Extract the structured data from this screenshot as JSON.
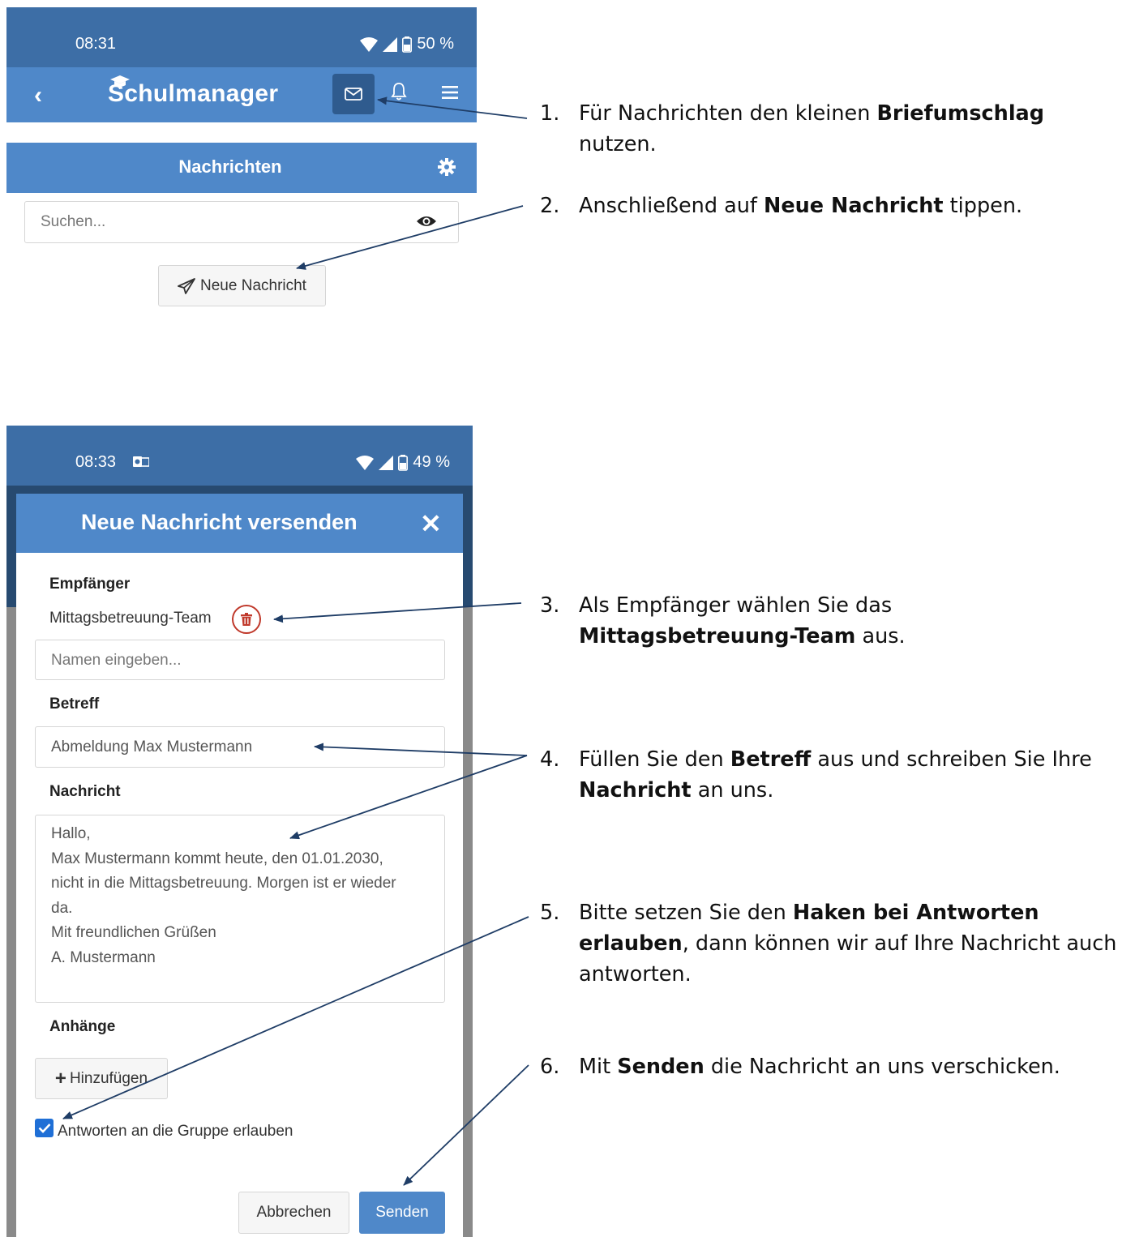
{
  "screen1": {
    "status": {
      "time": "08:31",
      "battery": "50 %"
    },
    "app": {
      "logo": "Schulmanager",
      "back_icon": "chevron-left-icon",
      "mail_icon": "envelope-icon",
      "bell_icon": "bell-icon",
      "menu_icon": "hamburger-menu-icon"
    },
    "section_title": "Nachrichten",
    "search_placeholder": "Suchen...",
    "new_message_label": "Neue Nachricht"
  },
  "screen2": {
    "status": {
      "time": "08:33",
      "battery": "49 %"
    },
    "modal_title": "Neue Nachricht versenden",
    "recipients_label": "Empfänger",
    "recipient": "Mittagsbetreuung-Team",
    "name_placeholder": "Namen eingeben...",
    "subject_label": "Betreff",
    "subject_value": "Abmeldung Max Mustermann",
    "message_label": "Nachricht",
    "message_lines": [
      "Hallo,",
      "Max Mustermann kommt heute, den 01.01.2030,",
      "nicht in die Mittagsbetreuung. Morgen ist er wieder",
      "da.",
      "Mit freundlichen Grüßen",
      "A. Mustermann"
    ],
    "attachments_label": "Anhänge",
    "add_label": "Hinzufügen",
    "allow_replies_label": "Antworten an die Gruppe erlauben",
    "allow_replies_checked": true,
    "cancel_label": "Abbrechen",
    "send_label": "Senden"
  },
  "steps": [
    {
      "num": "1.",
      "parts": [
        {
          "t": "Für Nachrichten den kleinen "
        },
        {
          "t": "Briefumschlag",
          "b": true
        },
        {
          "t": " nutzen."
        }
      ]
    },
    {
      "num": "2.",
      "parts": [
        {
          "t": "Anschließend auf "
        },
        {
          "t": "Neue Nachricht",
          "b": true
        },
        {
          "t": " tippen."
        }
      ]
    },
    {
      "num": "3.",
      "parts": [
        {
          "t": "Als Empfänger wählen Sie das "
        },
        {
          "t": "Mittagsbetreuung-Team",
          "b": true
        },
        {
          "t": " aus."
        }
      ]
    },
    {
      "num": "4.",
      "parts": [
        {
          "t": "Füllen Sie den "
        },
        {
          "t": "Betreff",
          "b": true
        },
        {
          "t": " aus und schreiben Sie Ihre "
        },
        {
          "t": "Nachricht",
          "b": true
        },
        {
          "t": " an uns."
        }
      ]
    },
    {
      "num": "5.",
      "parts": [
        {
          "t": "Bitte setzen Sie den "
        },
        {
          "t": "Haken bei Antworten erlauben",
          "b": true
        },
        {
          "t": ", dann können wir auf Ihre Nachricht auch antworten."
        }
      ]
    },
    {
      "num": "6.",
      "parts": [
        {
          "t": "Mit "
        },
        {
          "t": "Senden",
          "b": true
        },
        {
          "t": " die Nachricht an uns verschicken."
        }
      ]
    }
  ],
  "colors": {
    "status_bar": "#3d6ea6",
    "app_bar": "#4f88c9",
    "arrow": "#1f3d66",
    "checkbox": "#1f6fd6",
    "trash": "#c0392b"
  }
}
